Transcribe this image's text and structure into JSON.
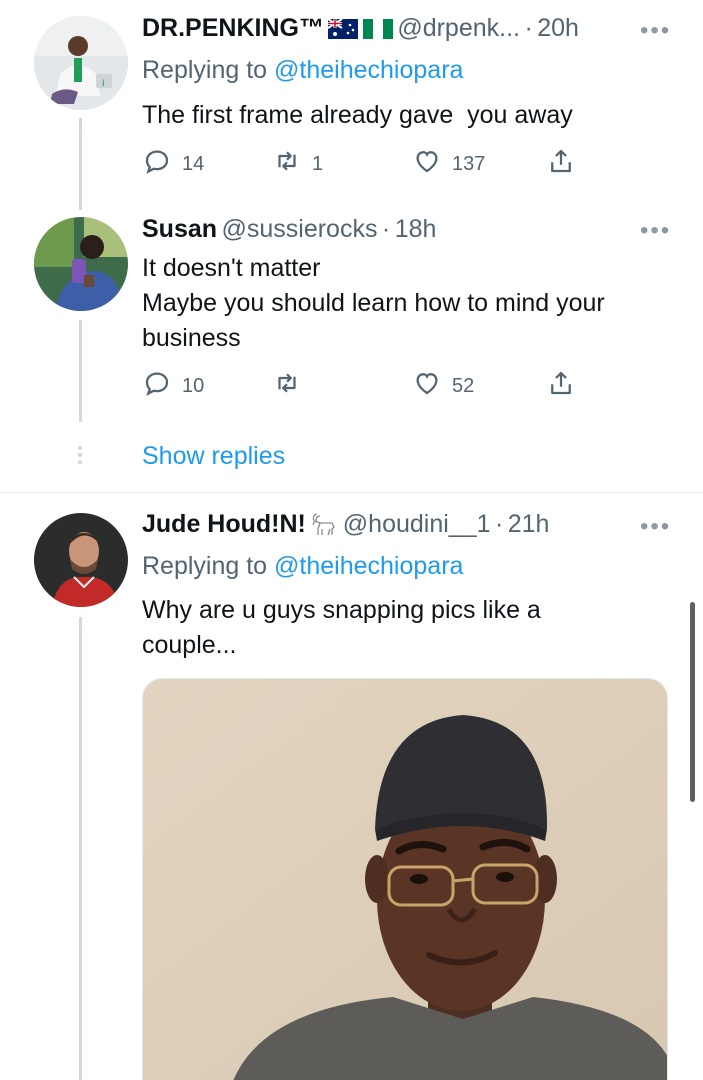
{
  "tweets": [
    {
      "name": "DR.PENKING™",
      "handle": "@drpenk...",
      "separator": "·",
      "time": "20h",
      "replying_prefix": "Replying to",
      "replying_to": "@theihechiopara",
      "text": "The first frame already gave  you away",
      "replies": "14",
      "retweets": "1",
      "likes": "137",
      "flags": [
        "australia-flag",
        "nigeria-flag"
      ]
    },
    {
      "name": "Susan",
      "handle": "@sussierocks",
      "separator": "·",
      "time": "18h",
      "text_line1": "It doesn't matter",
      "text_line2": "Maybe you should learn how to mind your",
      "text_line3": "business",
      "replies": "10",
      "retweets": "",
      "likes": "52"
    },
    {
      "name": "Jude Houd!N!",
      "name_emoji": "goat-icon",
      "handle": "@houdini__1",
      "separator": "·",
      "time": "21h",
      "replying_prefix": "Replying to",
      "replying_to": "@theihechiopara",
      "text_line1": "Why are u guys snapping pics like a",
      "text_line2": "couple..."
    }
  ],
  "show_replies_label": "Show replies",
  "more_label": "•••",
  "colors": {
    "link": "#1d9bf0",
    "secondary": "#536471",
    "thread_line": "#cfd9de"
  }
}
